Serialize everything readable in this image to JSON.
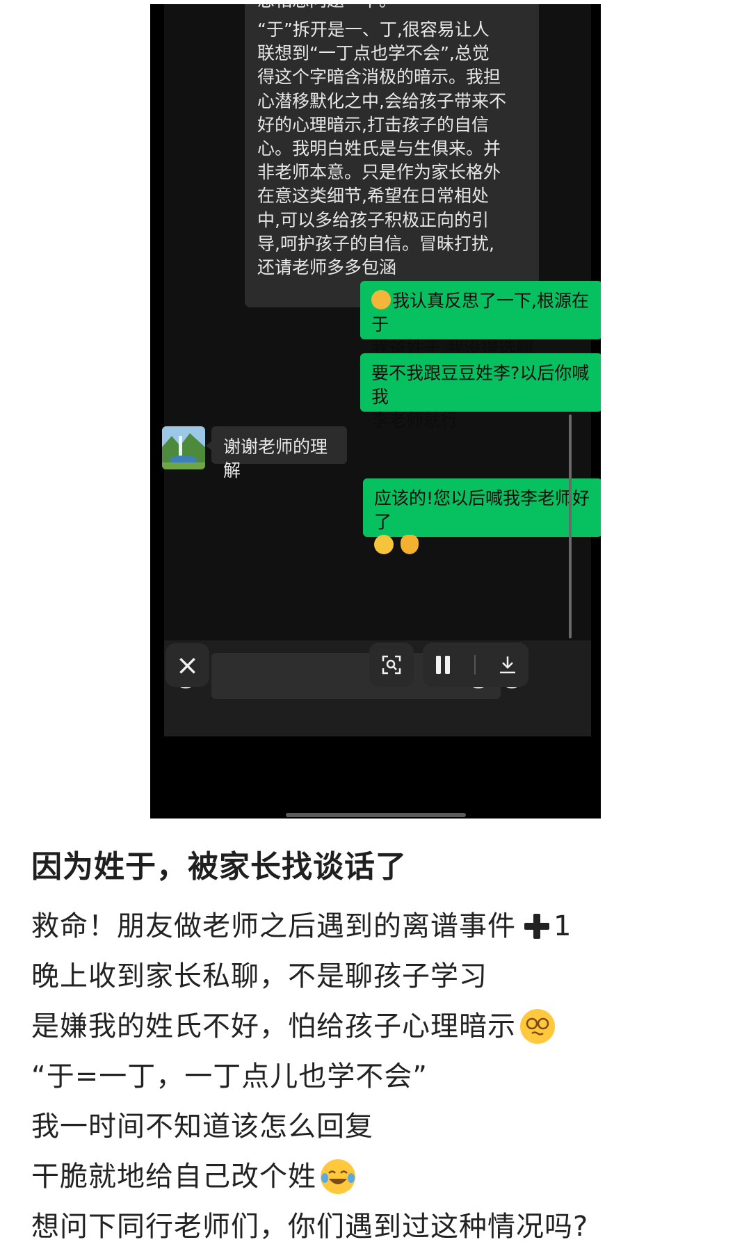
{
  "chat": {
    "long_message": {
      "cut_line": "想相想问题一下。",
      "text": "“于”拆开是一、丁,很容易让人\n联想到“一丁点也学不会”,总觉\n得这个字暗含消极的暗示。我担\n心潜移默化之中,会给孩子带来不\n好的心理暗示,打击孩子的自信\n心。我明白姓氏是与生俱来。并\n非老师本意。只是作为家长格外\n在意这类细节,希望在日常相处\n中,可以多给孩子积极正向的引\n导,呵护孩子的自信。冒昧打扰,\n还请老师多多包涵"
    },
    "messages": [
      {
        "side": "out",
        "text": "我认真反思了一下,根源在于\n我爸姓于,我没得选啊",
        "emoji": "face-with-monocle-icon"
      },
      {
        "side": "out",
        "text": "要不我跟豆豆姓李?以后你喊我\n李老师就行"
      },
      {
        "side": "in",
        "text": "谢谢老师的理解"
      },
      {
        "side": "out",
        "text": "应该的!您以后喊我李老师好了",
        "emoji": "smile-ok-hand-icons"
      }
    ]
  },
  "controls": {
    "close": "×",
    "screenshot": "screen-scan-icon",
    "pause": "pause-icon",
    "download": "download-icon"
  },
  "post": {
    "title": "因为姓于，被家长找谈话了",
    "lines": [
      "救命！朋友做老师之后遇到的离谱事件",
      "1",
      "晚上收到家长私聊，不是聊孩子学习",
      "是嫌我的姓氏不好，怕给孩子心理暗示",
      "“于=一丁，一丁点儿也学不会”",
      "我一时间不知道该怎么回复",
      "干脆就地给自己改个姓",
      "想问下同行老师们，你们遇到过这种情况吗?"
    ]
  }
}
